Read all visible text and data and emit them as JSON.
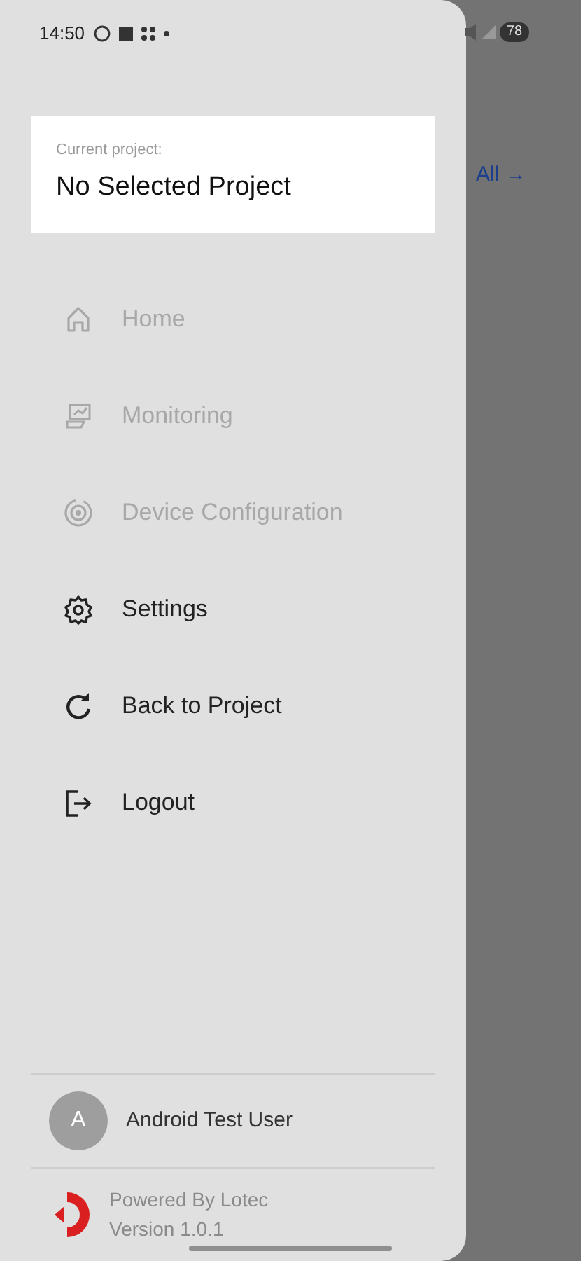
{
  "status_bar": {
    "time": "14:50",
    "battery": "78"
  },
  "background": {
    "link_text": "All",
    "link_arrow": "→"
  },
  "drawer": {
    "project_label": "Current project:",
    "project_name": "No Selected Project",
    "menu": [
      {
        "kind": "home",
        "label": "Home",
        "disabled": true
      },
      {
        "kind": "monitoring",
        "label": "Monitoring",
        "disabled": true
      },
      {
        "kind": "device",
        "label": "Device Configuration",
        "disabled": true
      },
      {
        "kind": "settings",
        "label": "Settings",
        "disabled": false
      },
      {
        "kind": "refresh",
        "label": "Back to Project",
        "disabled": false
      },
      {
        "kind": "logout",
        "label": "Logout",
        "disabled": false
      }
    ],
    "user": {
      "initial": "A",
      "name": "Android Test User"
    },
    "footer": {
      "powered_by": "Powered By Lotec",
      "version": "Version 1.0.1"
    }
  }
}
